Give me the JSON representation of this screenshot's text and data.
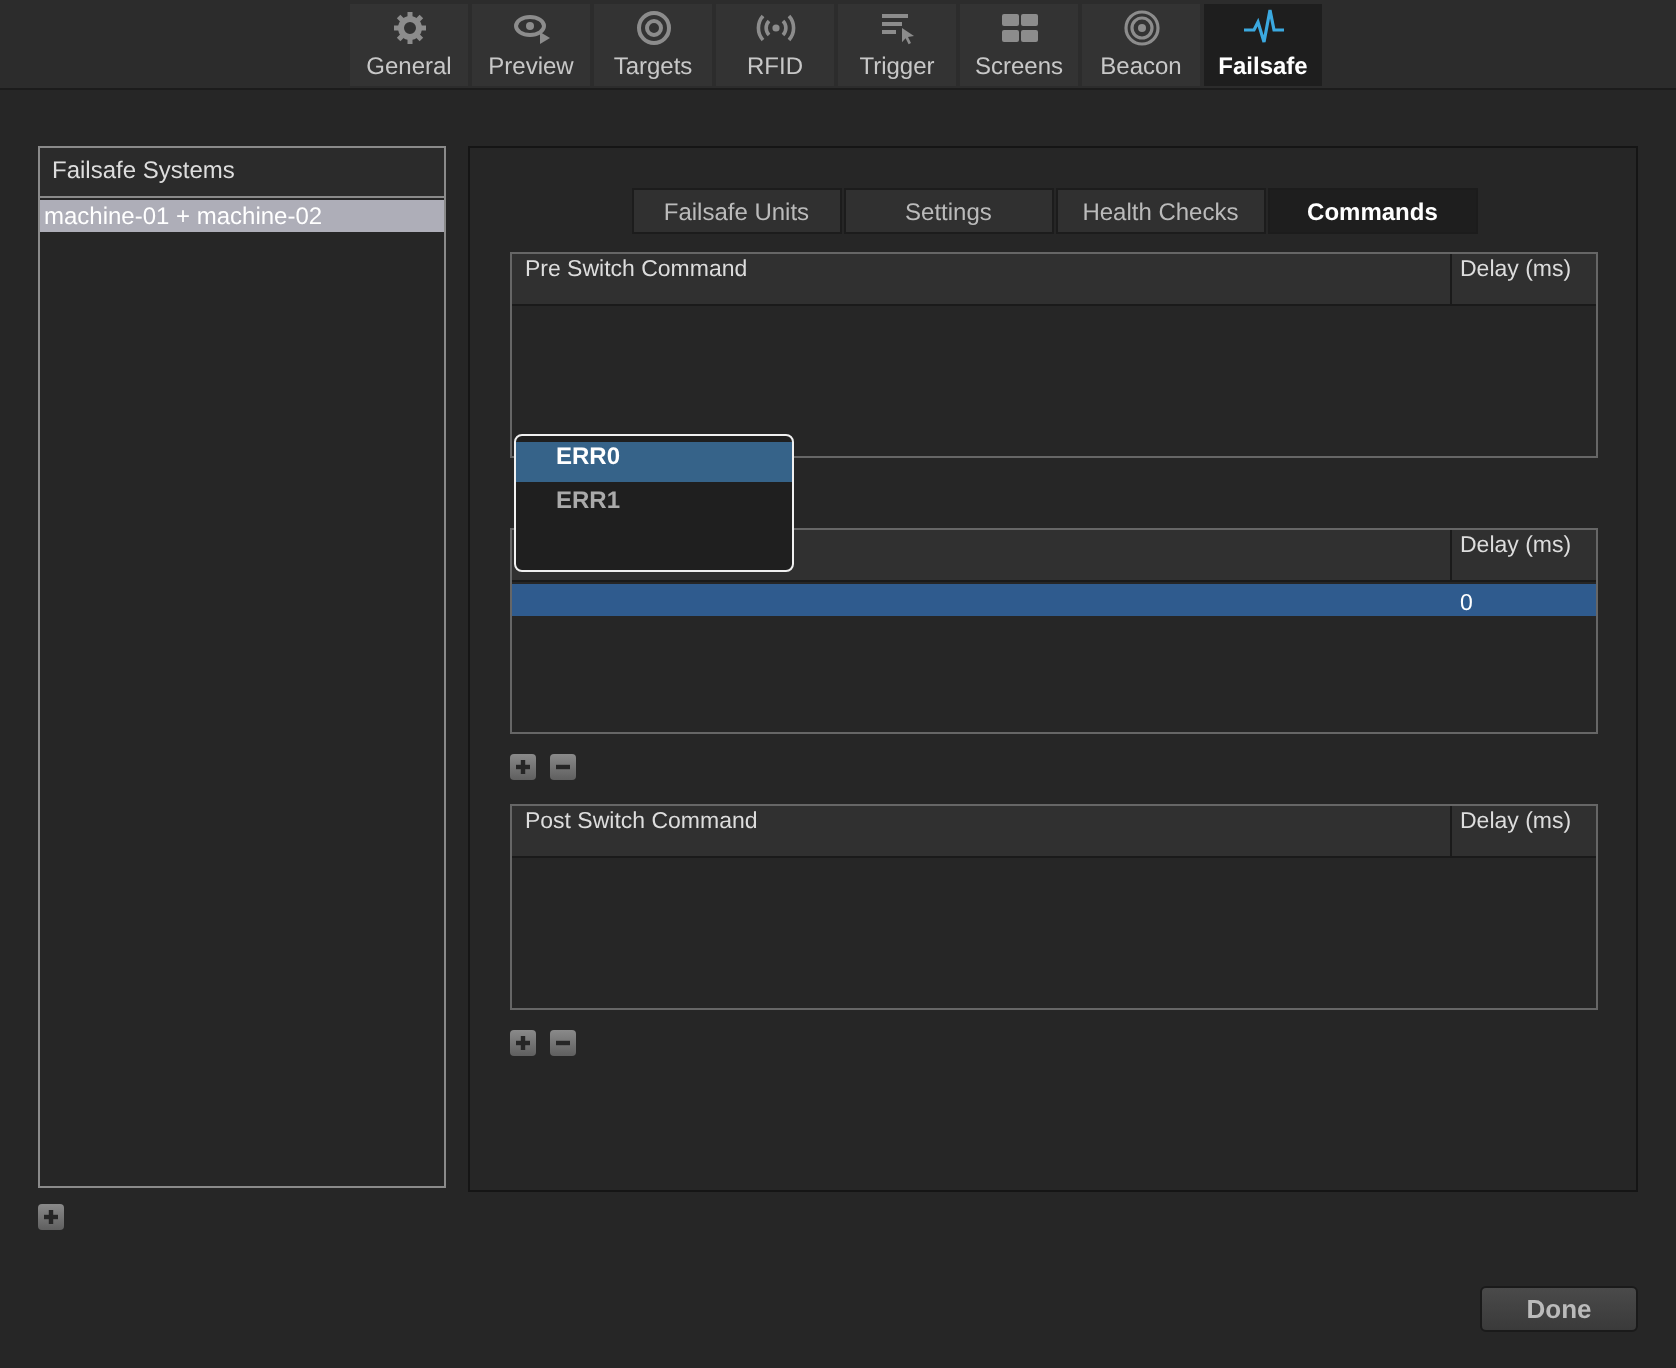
{
  "toolbar": {
    "tabs": [
      {
        "label": "General",
        "kind": "gear",
        "selected": false
      },
      {
        "label": "Preview",
        "kind": "eye",
        "selected": false
      },
      {
        "label": "Targets",
        "kind": "target",
        "selected": false
      },
      {
        "label": "RFID",
        "kind": "signal",
        "selected": false
      },
      {
        "label": "Trigger",
        "kind": "list",
        "selected": false
      },
      {
        "label": "Screens",
        "kind": "grid",
        "selected": false
      },
      {
        "label": "Beacon",
        "kind": "beacon",
        "selected": false
      },
      {
        "label": "Failsafe",
        "kind": "pulse",
        "selected": true
      }
    ]
  },
  "sidebar": {
    "title": "Failsafe Systems",
    "items": [
      {
        "label": "machine-01 + machine-02",
        "selected": true
      }
    ],
    "add_button": true
  },
  "panel": {
    "tabs": [
      {
        "label": "Failsafe Units",
        "selected": false
      },
      {
        "label": "Settings",
        "selected": false
      },
      {
        "label": "Health Checks",
        "selected": false
      },
      {
        "label": "Commands",
        "selected": true
      }
    ],
    "tables": [
      {
        "header": "Pre Switch Command",
        "delay_header": "Delay (ms)"
      },
      {
        "delay_header": "Delay (ms)",
        "rows": [
          {
            "delay": "0",
            "selected": true
          }
        ],
        "add_remove_buttons": true
      },
      {
        "header": "Post Switch Command",
        "delay_header": "Delay (ms)",
        "add_remove_buttons": true
      }
    ]
  },
  "popup_menu": {
    "items": [
      {
        "label": "ERR0",
        "selected": true
      },
      {
        "label": "ERR1",
        "selected": false
      }
    ]
  },
  "done_button": "Done"
}
